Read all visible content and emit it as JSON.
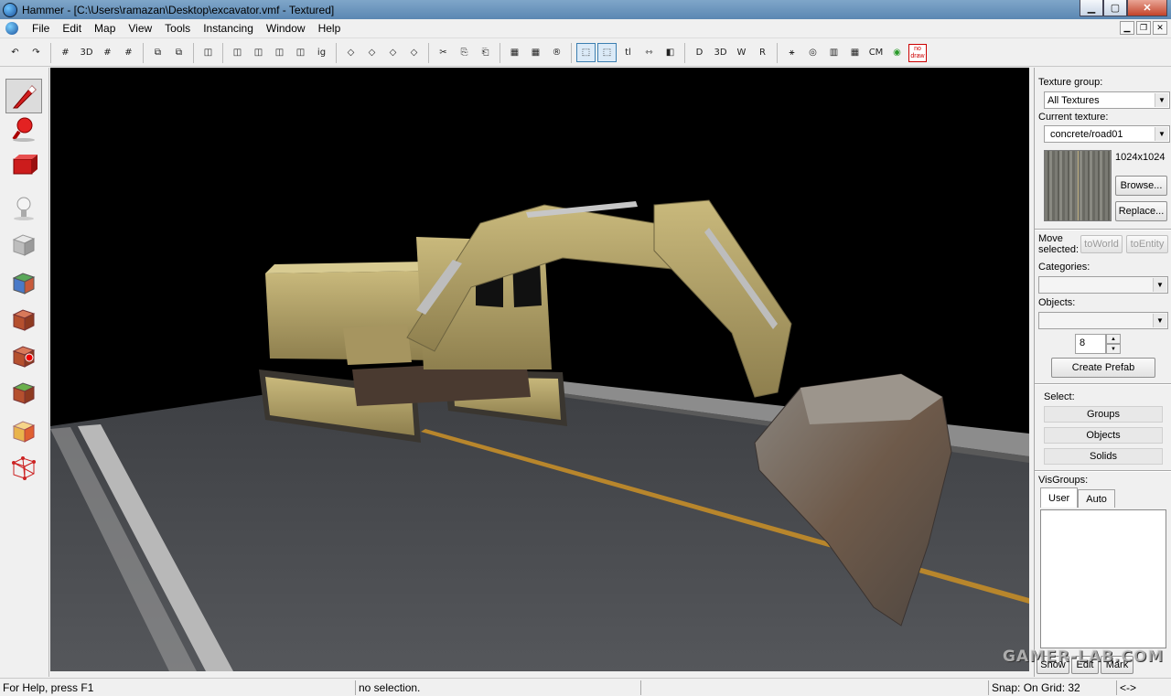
{
  "window": {
    "title": "Hammer - [C:\\Users\\ramazan\\Desktop\\excavator.vmf - Textured]",
    "controls": [
      "minimize",
      "maximize",
      "close"
    ]
  },
  "menu": {
    "items": [
      "File",
      "Edit",
      "Map",
      "View",
      "Tools",
      "Instancing",
      "Window",
      "Help"
    ]
  },
  "toolbar": {
    "glyphs": [
      "↶",
      "↷",
      "#",
      "3D",
      "#",
      "#",
      "⧉",
      "⧉",
      "◫",
      "◫",
      "◫",
      "◫",
      "◫",
      "ig",
      "◇",
      "◇",
      "◇",
      "◇",
      "✂",
      "⎘",
      "⎗",
      "▦",
      "▦",
      "®",
      "⬚",
      "⬚",
      "tl",
      "⇿",
      "◧",
      "D",
      "3D",
      "W",
      "R",
      "⚹",
      "◎",
      "▥",
      "▦",
      "CM",
      "◉"
    ],
    "nodraw_line1": "no",
    "nodraw_line2": "draw"
  },
  "tools": [
    "selection-tool",
    "magnify-tool",
    "camera-tool",
    "entity-tool",
    "block-tool",
    "texture-application-tool",
    "apply-current-texture-tool",
    "decal-tool",
    "overlay-tool",
    "clipping-tool",
    "vertex-tool"
  ],
  "panel": {
    "texture_group_label": "Texture group:",
    "texture_group_value": "All Textures",
    "current_texture_label": "Current texture:",
    "current_texture_value": "concrete/road01",
    "texture_size": "1024x1024",
    "browse_label": "Browse...",
    "replace_label": "Replace...",
    "move_label_1": "Move",
    "move_label_2": "selected:",
    "to_world_label": "toWorld",
    "to_entity_label": "toEntity",
    "categories_label": "Categories:",
    "objects_label": "Objects:",
    "spin_value": "8",
    "create_prefab_label": "Create Prefab",
    "select_label": "Select:",
    "groups_label": "Groups",
    "objects_btn_label": "Objects",
    "solids_label": "Solids",
    "visgroups_label": "VisGroups:",
    "tab_user": "User",
    "tab_auto": "Auto",
    "bottom_show": "Show",
    "bottom_edit": "Edit",
    "bottom_mark": "Mark"
  },
  "status": {
    "help": "For Help, press F1",
    "selection": "no selection.",
    "snap": "Snap: On Grid: 32",
    "arrows": "<->"
  },
  "watermark": "GAMER-LAB.COM"
}
